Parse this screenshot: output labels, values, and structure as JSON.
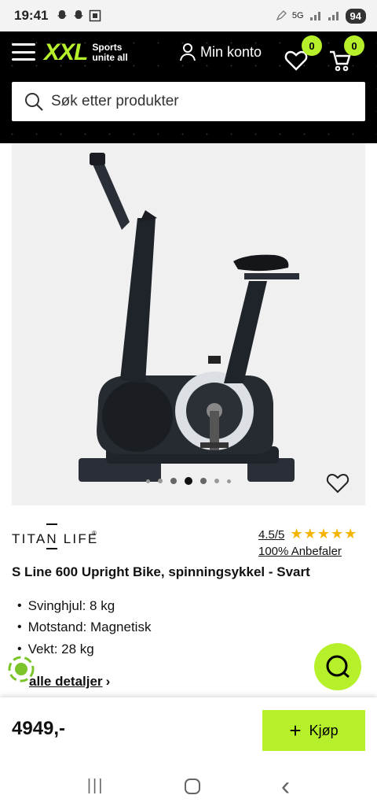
{
  "status_bar": {
    "time": "19:41",
    "network": "5G",
    "battery": "94"
  },
  "header": {
    "logo_text": "XXL",
    "logo_tagline_1": "Sports",
    "logo_tagline_2": "unite all",
    "account_label": "Min konto",
    "wishlist_count": "0",
    "cart_count": "0",
    "search_placeholder": "Søk etter produkter"
  },
  "gallery": {
    "image_count": 7,
    "active_index": 3
  },
  "product": {
    "brand": "TITAN LIFE",
    "brand_mark": "®",
    "rating": "4.5/5",
    "rating_value": 4.5,
    "stars": "★★★★★",
    "recommend": "100% Anbefaler",
    "title": "S Line 600 Upright Bike, spinningsykkel - Svart",
    "specs": [
      "Svinghjul: 8 kg",
      "Motstand: Magnetisk",
      "Vekt: 28 kg"
    ],
    "details_link": "alle detaljer",
    "details_chevron": "›"
  },
  "buy_bar": {
    "price": "4949,-",
    "buy_label": "Kjøp",
    "buy_icon": "+"
  },
  "colors": {
    "accent": "#b5f02b",
    "header_bg": "#000000",
    "star": "#f5b400"
  },
  "nav": {
    "recents": "|||",
    "back": "‹"
  }
}
